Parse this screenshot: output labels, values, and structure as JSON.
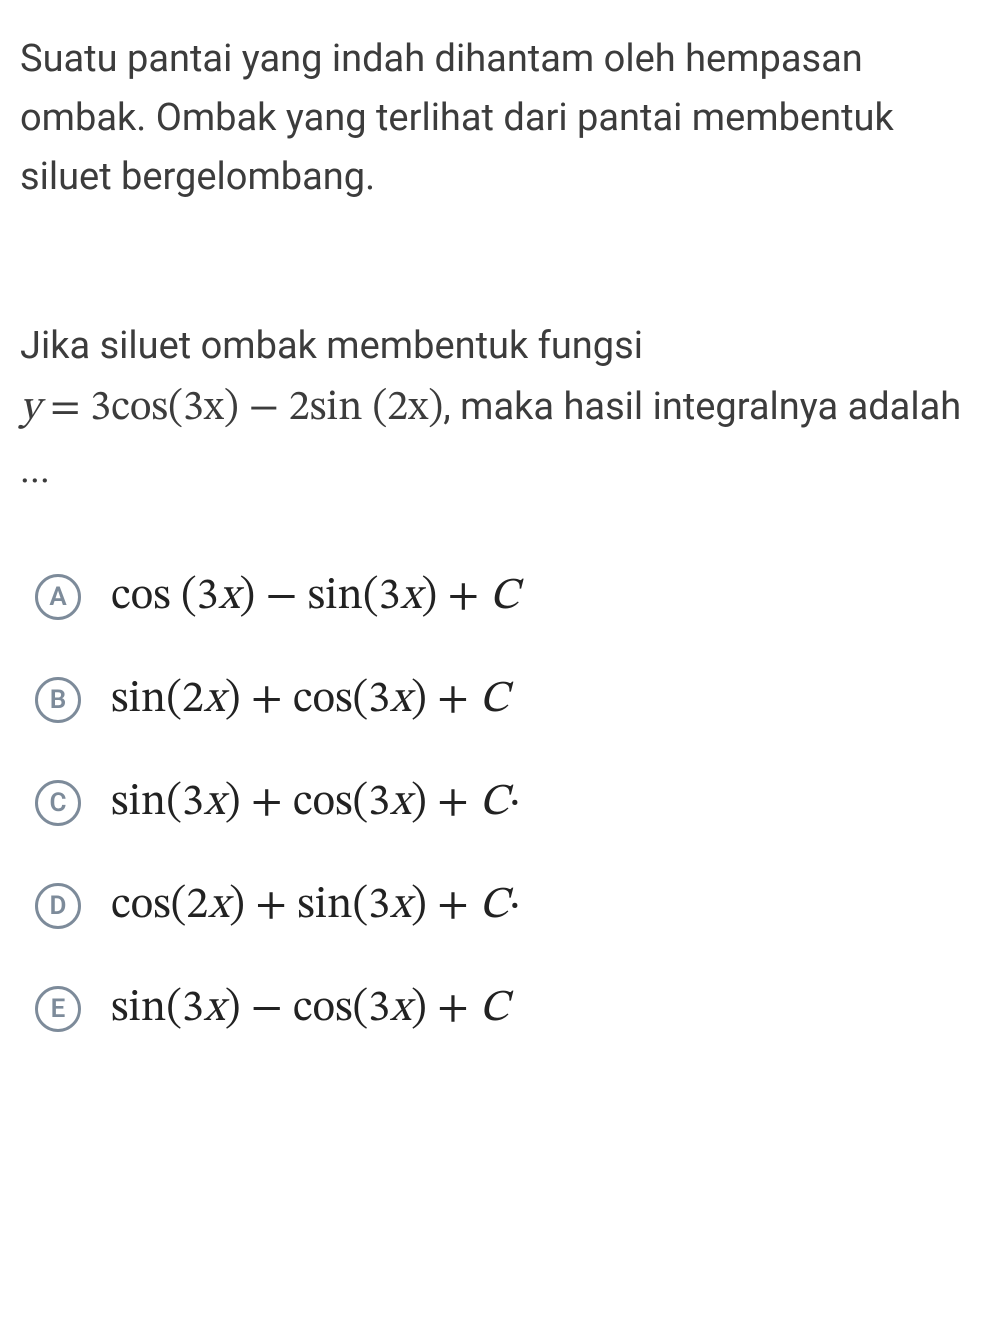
{
  "context": "Suatu pantai yang indah dihantam oleh hempasan ombak. Ombak yang terlihat dari pantai membentuk siluet bergelombang.",
  "question": {
    "prefix": "Jika siluet ombak membentuk fungsi",
    "equation_lhs": "y",
    "equation_rhs_1": "3cos(3x)",
    "equation_op": "−",
    "equation_rhs_2": "2sin (2x)",
    "suffix": ", maka hasil integralnya adalah ..."
  },
  "options": [
    {
      "label": "A",
      "expr": "cos (3x) − sin(3x) + C"
    },
    {
      "label": "B",
      "expr": "sin(2x) + cos(3x) + C"
    },
    {
      "label": "C",
      "expr": "sin(3x) + cos(3x) + C·"
    },
    {
      "label": "D",
      "expr": "cos(2x) + sin(3x) + C·"
    },
    {
      "label": "E",
      "expr": "sin(3x) − cos(3x) + C"
    }
  ]
}
